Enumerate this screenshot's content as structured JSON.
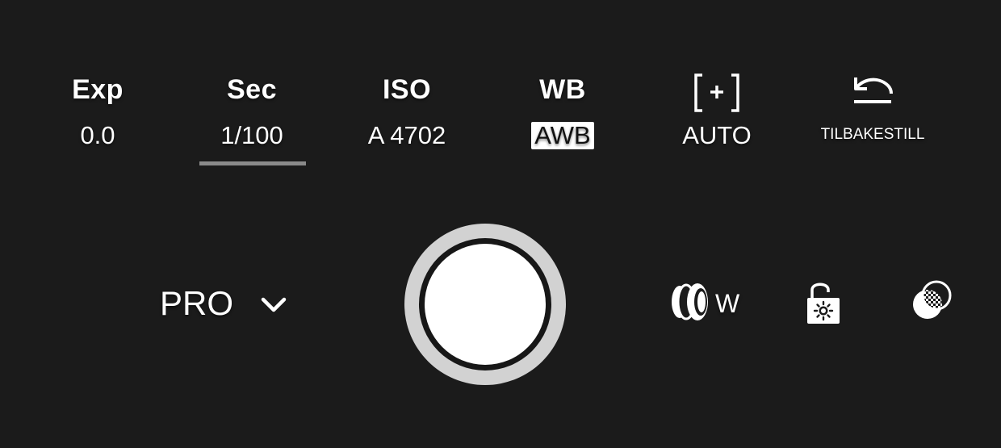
{
  "controls": [
    {
      "id": "exp",
      "label": "Exp",
      "value": "0.0"
    },
    {
      "id": "sec",
      "label": "Sec",
      "value": "1/100",
      "selected": true
    },
    {
      "id": "iso",
      "label": "ISO",
      "value": "A 4702"
    },
    {
      "id": "wb",
      "label": "WB",
      "value": "AWB"
    },
    {
      "id": "focus",
      "icon": "focus-bracket-icon",
      "value": "AUTO"
    },
    {
      "id": "reset",
      "icon": "reset-arrow-icon",
      "value": "TILBAKESTILL"
    }
  ],
  "mode": {
    "label": "PRO",
    "icon": "chevron-down-icon"
  },
  "shutter": {
    "icon": "shutter-button"
  },
  "tools": {
    "lens_label": "W",
    "lens_icon": "lens-icon",
    "ae_lock_icon": "exposure-lock-icon",
    "filter_icon": "filter-effect-icon"
  },
  "colors": {
    "background": "#1b1b1b",
    "text": "#ffffff",
    "selected_underline": "#8a8a8a",
    "shutter_outer": "#d2d2d2"
  }
}
